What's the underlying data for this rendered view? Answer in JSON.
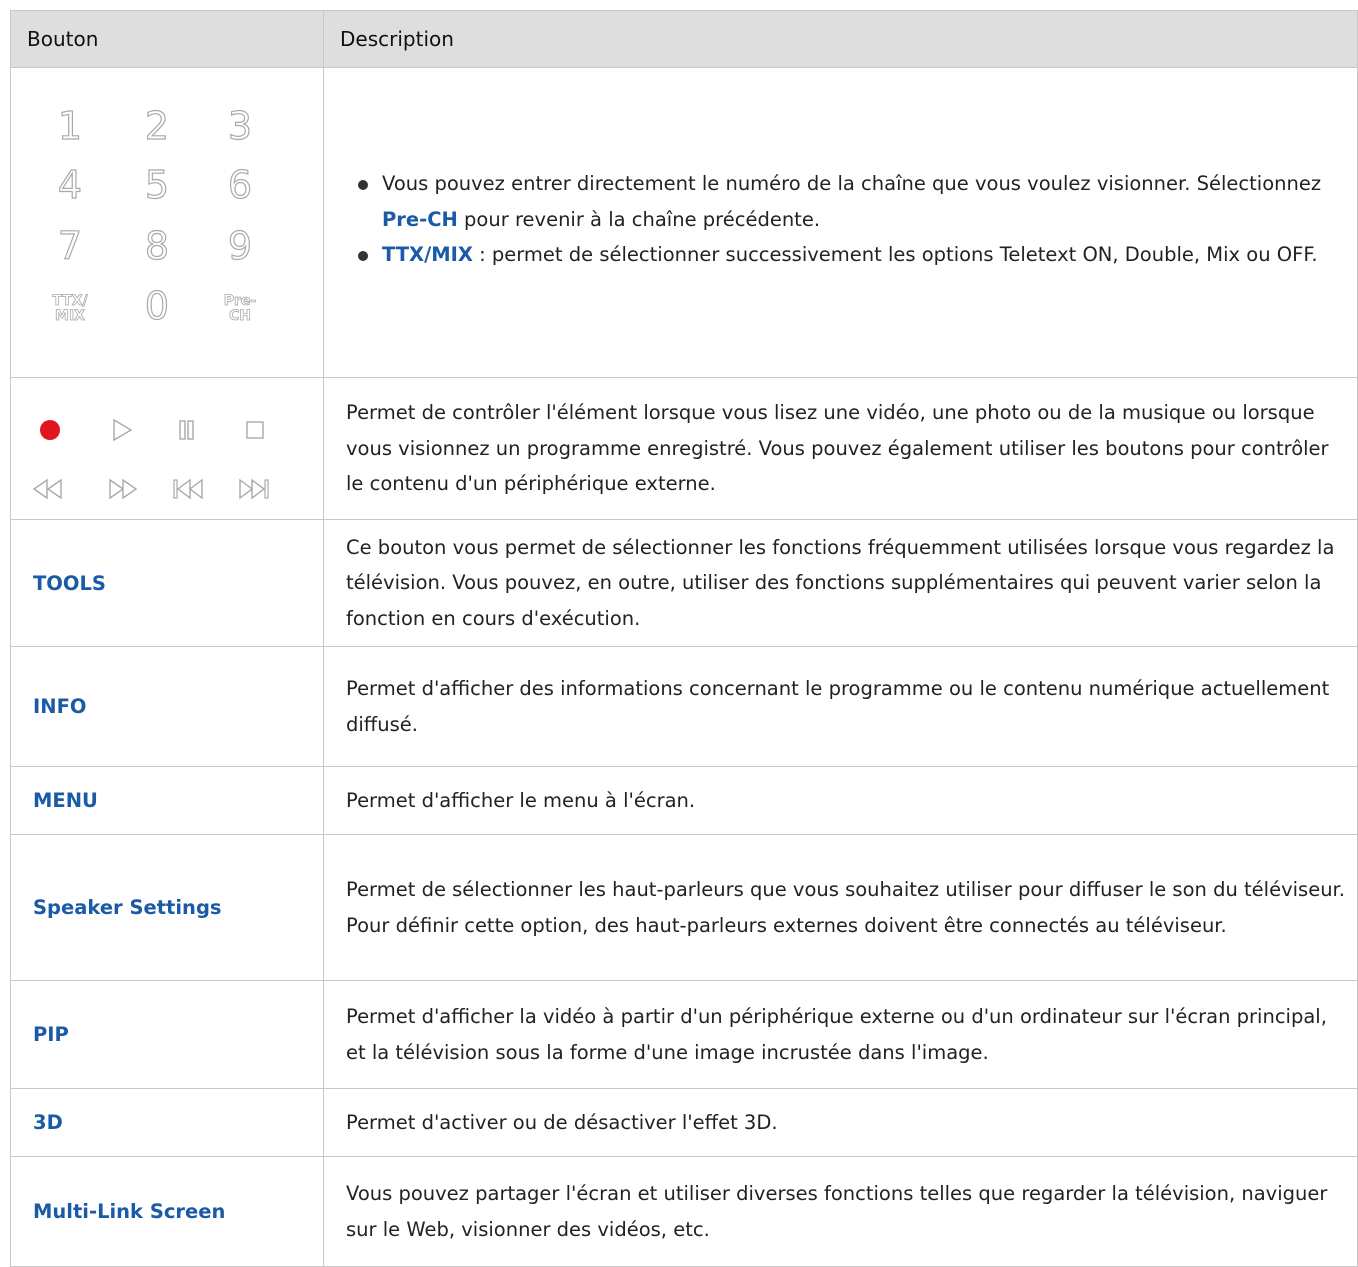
{
  "header": {
    "col1": "Bouton",
    "col2": "Description"
  },
  "keypad": {
    "digits": [
      "1",
      "2",
      "3",
      "4",
      "5",
      "6",
      "7",
      "8",
      "9",
      "0"
    ],
    "ttx_line1": "TTX/",
    "ttx_line2": "MIX",
    "prech_line1": "Pre-",
    "prech_line2": "CH",
    "bullet1_text": "Vous pouvez entrer directement le numéro de la chaîne que vous voulez visionner. Sélectionnez ",
    "bullet1_key": "Pre-CH",
    "bullet1_tail": " pour revenir à la chaîne précédente.",
    "bullet2_key": "TTX/MIX",
    "bullet2_text": " : permet de sélectionner successivement les options Teletext ON, Double, Mix ou OFF."
  },
  "playback": {
    "icons": [
      "record-icon",
      "play-icon",
      "pause-icon",
      "stop-icon",
      "rewind-icon",
      "fast-forward-icon",
      "skip-back-icon",
      "skip-forward-icon"
    ],
    "record_color": "#e2141e",
    "description": "Permet de contrôler l'élément lorsque vous lisez une vidéo, une photo ou de la musique ou lorsque vous visionnez un programme enregistré. Vous pouvez également utiliser les boutons pour contrôler le contenu d'un périphérique externe."
  },
  "rows": [
    {
      "key": "TOOLS",
      "desc": "Ce bouton vous permet de sélectionner les fonctions fréquemment utilisées lorsque vous regardez la télévision. Vous pouvez, en outre, utiliser des fonctions supplémentaires qui peuvent varier selon la fonction en cours d'exécution."
    },
    {
      "key": "INFO",
      "desc": "Permet d'afficher des informations concernant le programme ou le contenu numérique actuellement diffusé."
    },
    {
      "key": "MENU",
      "desc": "Permet d'afficher le menu à l'écran."
    },
    {
      "key": "Speaker Settings",
      "desc": "Permet de sélectionner les haut-parleurs que vous souhaitez utiliser pour diffuser le son du téléviseur. Pour définir cette option, des haut-parleurs externes doivent être connectés au téléviseur."
    },
    {
      "key": "PIP",
      "desc": "Permet d'afficher la vidéo à partir d'un périphérique externe ou d'un ordinateur sur l'écran principal, et la télévision sous la forme d'une image incrustée dans l'image."
    },
    {
      "key": "3D",
      "desc": "Permet d'activer ou de désactiver l'effet 3D."
    },
    {
      "key": "Multi-Link Screen",
      "desc": "Vous pouvez partager l'écran et utiliser diverses fonctions telles que regarder la télévision, naviguer sur le Web, visionner des vidéos, etc."
    }
  ],
  "colors": {
    "accent": "#1a5aa6",
    "header_bg": "#dedede",
    "border": "#c8c8c8",
    "icon_gray": "#a9a9a9"
  }
}
